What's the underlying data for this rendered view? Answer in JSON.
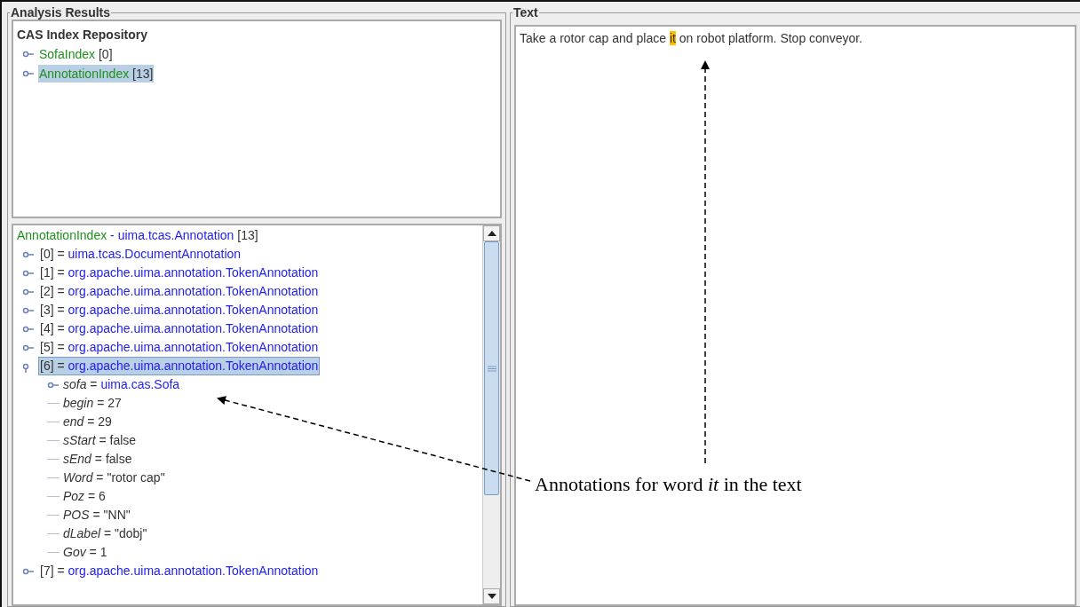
{
  "analysis_panel": {
    "title": "Analysis Results",
    "repository": {
      "title": "CAS Index Repository",
      "items": [
        {
          "name": "SofaIndex",
          "count": "[0]",
          "selected": false
        },
        {
          "name": "AnnotationIndex",
          "count": "[13]",
          "selected": true
        }
      ]
    },
    "annotation_tree": {
      "index": "AnnotationIndex",
      "separator": "-",
      "type": "uima.tcas.Annotation",
      "count": "[13]",
      "operator": "=",
      "items": [
        {
          "index": "[0]",
          "type": "uima.tcas.DocumentAnnotation",
          "expanded": false,
          "selected": false
        },
        {
          "index": "[1]",
          "type": "org.apache.uima.annotation.TokenAnnotation",
          "expanded": false,
          "selected": false
        },
        {
          "index": "[2]",
          "type": "org.apache.uima.annotation.TokenAnnotation",
          "expanded": false,
          "selected": false
        },
        {
          "index": "[3]",
          "type": "org.apache.uima.annotation.TokenAnnotation",
          "expanded": false,
          "selected": false
        },
        {
          "index": "[4]",
          "type": "org.apache.uima.annotation.TokenAnnotation",
          "expanded": false,
          "selected": false
        },
        {
          "index": "[5]",
          "type": "org.apache.uima.annotation.TokenAnnotation",
          "expanded": false,
          "selected": false
        },
        {
          "index": "[6]",
          "type": "org.apache.uima.annotation.TokenAnnotation",
          "expanded": true,
          "selected": true,
          "children": [
            {
              "feature": "sofa",
              "value": "uima.cas.Sofa",
              "kind": "reference"
            },
            {
              "feature": "begin",
              "value": "27",
              "kind": "primitive"
            },
            {
              "feature": "end",
              "value": "29",
              "kind": "primitive"
            },
            {
              "feature": "sStart",
              "value": "false",
              "kind": "primitive"
            },
            {
              "feature": "sEnd",
              "value": "false",
              "kind": "primitive"
            },
            {
              "feature": "Word",
              "value": "\"rotor cap\"",
              "kind": "primitive"
            },
            {
              "feature": "Poz",
              "value": "6",
              "kind": "primitive"
            },
            {
              "feature": "POS",
              "value": "\"NN\"",
              "kind": "primitive"
            },
            {
              "feature": "dLabel",
              "value": "\"dobj\"",
              "kind": "primitive"
            },
            {
              "feature": "Gov",
              "value": "1",
              "kind": "primitive"
            }
          ]
        },
        {
          "index": "[7]",
          "type": "org.apache.uima.annotation.TokenAnnotation",
          "expanded": false,
          "selected": false
        }
      ]
    }
  },
  "text_panel": {
    "title": "Text",
    "segments": [
      {
        "text": "Take a rotor cap and place ",
        "highlighted": false
      },
      {
        "text": "it",
        "highlighted": true
      },
      {
        "text": " on robot platform. Stop conveyor.",
        "highlighted": false
      }
    ]
  },
  "callout": {
    "text": "Annotations for word *it* in the text"
  }
}
